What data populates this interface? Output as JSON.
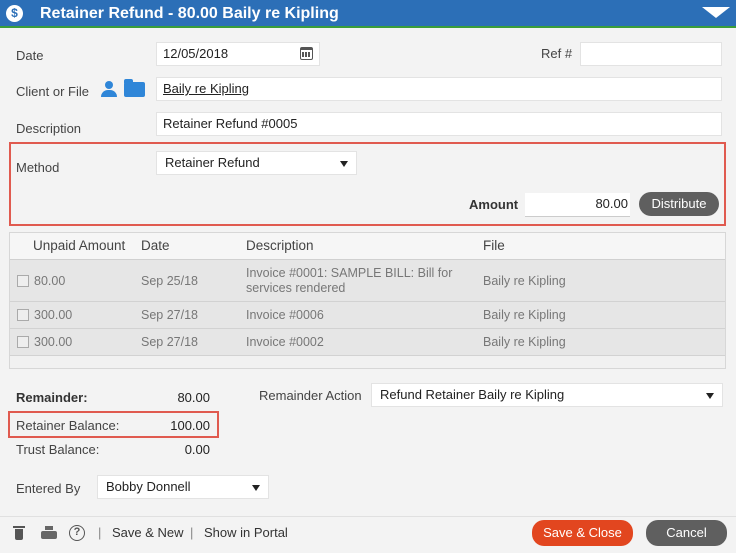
{
  "window": {
    "title": "Retainer Refund - 80.00 Baily re Kipling",
    "title_icon": "dollar-icon"
  },
  "form": {
    "date_label": "Date",
    "date_value": "12/05/2018",
    "ref_label": "Ref #",
    "ref_value": "",
    "client_label": "Client or File",
    "client_value": "Baily re Kipling",
    "description_label": "Description",
    "description_value": "Retainer Refund #0005",
    "method_label": "Method",
    "method_value": "Retainer Refund",
    "amount_label": "Amount",
    "amount_value": "80.00",
    "distribute_label": "Distribute"
  },
  "table": {
    "columns": [
      "Unpaid Amount",
      "Date",
      "Description",
      "File"
    ],
    "rows": [
      {
        "amount": "80.00",
        "date": "Sep 25/18",
        "description_line1": "Invoice #0001: SAMPLE BILL: Bill for",
        "description_line2": "services rendered",
        "file": "Baily re Kipling"
      },
      {
        "amount": "300.00",
        "date": "Sep 27/18",
        "description_line1": "Invoice #0006",
        "description_line2": "",
        "file": "Baily re Kipling"
      },
      {
        "amount": "300.00",
        "date": "Sep 27/18",
        "description_line1": "Invoice #0002",
        "description_line2": "",
        "file": "Baily re Kipling"
      }
    ]
  },
  "summary": {
    "remainder_label": "Remainder:",
    "remainder_value": "80.00",
    "retainer_balance_label": "Retainer Balance:",
    "retainer_balance_value": "100.00",
    "trust_balance_label": "Trust Balance:",
    "trust_balance_value": "0.00",
    "remainder_action_label": "Remainder Action",
    "remainder_action_value": "Refund Retainer Baily re Kipling",
    "entered_by_label": "Entered By",
    "entered_by_value": "Bobby Donnell"
  },
  "footer": {
    "save_new_label": "Save & New",
    "show_portal_label": "Show in Portal",
    "save_close_label": "Save & Close",
    "cancel_label": "Cancel",
    "separator": "|"
  },
  "colors": {
    "titlebar": "#2c6fb7",
    "highlight": "#e05a4f",
    "save_close": "#e2461f",
    "dark_button": "#5f5f5f",
    "icon_blue": "#2f86d8"
  }
}
